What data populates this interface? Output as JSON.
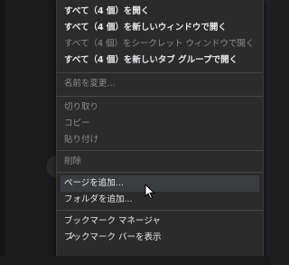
{
  "menu": {
    "items": [
      {
        "label": "すべて（4 個）を開く",
        "bold": true,
        "disabled": false
      },
      {
        "label": "すべて（4 個）を新しいウィンドウで開く",
        "bold": true,
        "disabled": false
      },
      {
        "label": "すべて（4 個）をシークレット ウィンドウで開く",
        "bold": false,
        "disabled": true
      },
      {
        "label": "すべて（4 個）を新しいタブ グループで開く",
        "bold": true,
        "disabled": false
      },
      {
        "label": "名前を変更...",
        "bold": false,
        "disabled": true
      },
      {
        "label": "切り取り",
        "bold": false,
        "disabled": true
      },
      {
        "label": "コピー",
        "bold": false,
        "disabled": true
      },
      {
        "label": "貼り付け",
        "bold": false,
        "disabled": true
      },
      {
        "label": "削除",
        "bold": false,
        "disabled": true
      },
      {
        "label": "ページを追加...",
        "bold": false,
        "disabled": false
      },
      {
        "label": "フォルダを追加...",
        "bold": false,
        "disabled": false
      },
      {
        "label": "ブックマーク マネージャ",
        "bold": false,
        "disabled": false
      },
      {
        "label": "ブックマーク バーを表示",
        "bold": false,
        "disabled": false,
        "checked": true
      }
    ],
    "check_glyph": "✓"
  }
}
